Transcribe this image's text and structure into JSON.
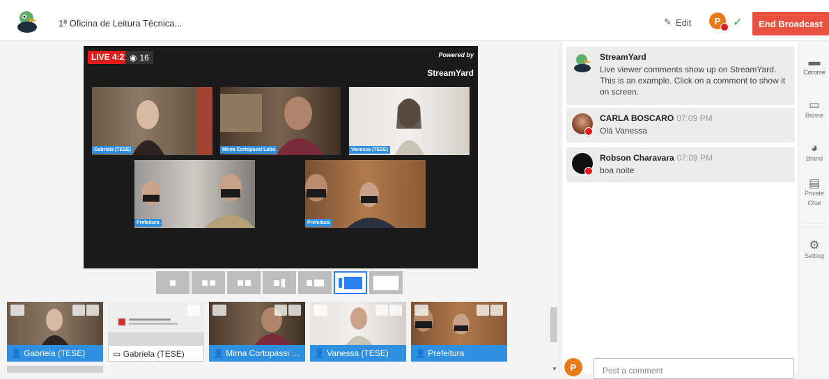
{
  "header": {
    "title": "1ª Oficina de Leitura Técnica...",
    "edit_label": "Edit",
    "destination_initial": "P",
    "end_broadcast_label": "End Broadcast"
  },
  "stage": {
    "live_label": "LIVE 4:21",
    "viewers": "16",
    "powered_by": "Powered by",
    "brand": "StreamYard",
    "participants": [
      {
        "label": "Gabriela (TESE)"
      },
      {
        "label": "Mirna Cortopassi Lobo"
      },
      {
        "label": "Vanessa (TESE)"
      },
      {
        "label": "Prefeitura"
      },
      {
        "label": "Prefeitura"
      }
    ]
  },
  "tiles": [
    {
      "label": "Gabriela (TESE)",
      "type": "camera"
    },
    {
      "label": "Gabriela (TESE)",
      "type": "screen"
    },
    {
      "label": "Mirna Cortopassi L...",
      "type": "camera"
    },
    {
      "label": "Vanessa (TESE)",
      "type": "camera"
    },
    {
      "label": "Prefeitura",
      "type": "camera"
    }
  ],
  "comments": [
    {
      "name": "StreamYard",
      "time": "",
      "text": "Live viewer comments show up on StreamYard. This is an example. Click on a comment to show it on screen."
    },
    {
      "name": "CARLA BOSCARO",
      "time": "07:09 PM",
      "text": "Olá Vanessa"
    },
    {
      "name": "Robson Charavara",
      "time": "07:09 PM",
      "text": "boa noite"
    }
  ],
  "post": {
    "placeholder": "Post a comment",
    "avatar_initial": "P"
  },
  "rail": {
    "items": [
      "Comme",
      "Banne",
      "Brand",
      "Private Chat",
      "Setting"
    ]
  },
  "colors": {
    "accent": "#2f8fe0",
    "end_broadcast": "#e9523e",
    "live": "#e21b1b"
  }
}
